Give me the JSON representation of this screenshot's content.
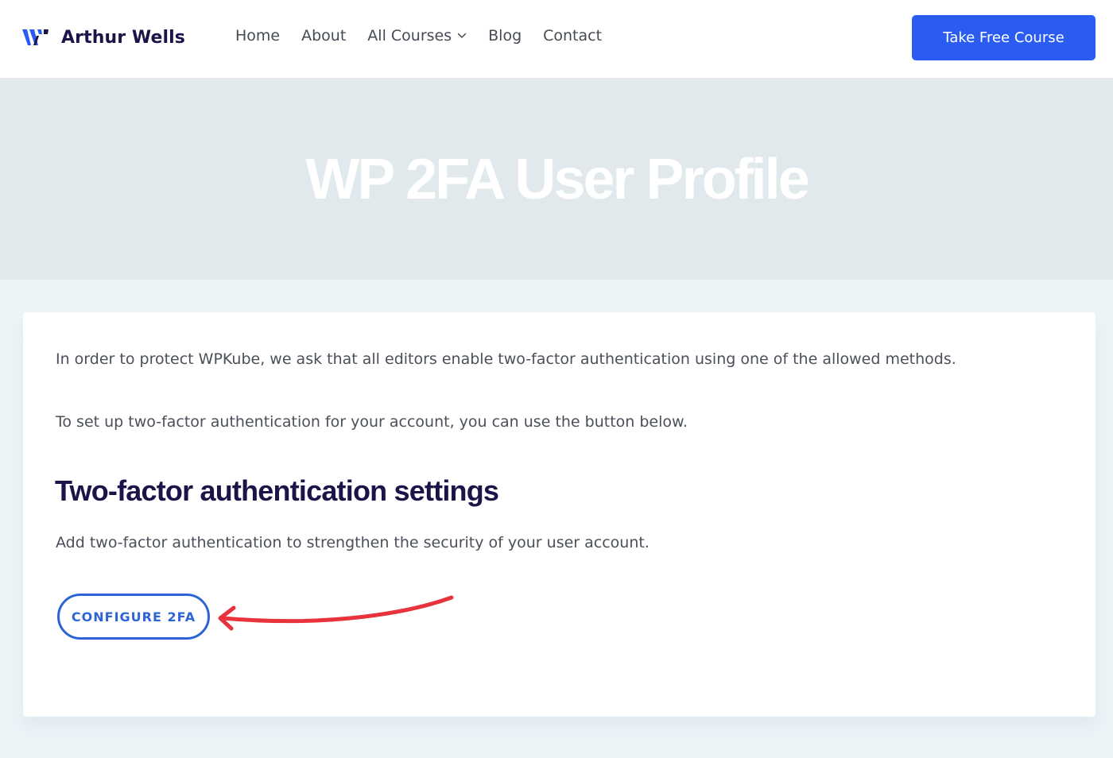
{
  "header": {
    "logo_text": "Arthur Wells",
    "logo_icon": "w-logo-icon",
    "nav": [
      {
        "label": "Home"
      },
      {
        "label": "About"
      },
      {
        "label": "All Courses",
        "has_dropdown": true
      },
      {
        "label": "Blog"
      },
      {
        "label": "Contact"
      }
    ],
    "cta_label": "Take Free Course"
  },
  "hero": {
    "title": "WP 2FA User Profile"
  },
  "content": {
    "intro": "In order to protect WPKube, we ask that all editors enable two-factor authentication using one of the allowed methods.",
    "setup_note": "To set up two-factor authentication for your account, you can use the button below.",
    "section_title": "Two-factor authentication settings",
    "section_desc": "Add two-factor authentication to strengthen the security of your user account.",
    "configure_label": "CONFIGURE 2FA"
  },
  "annotation": {
    "arrow_icon": "red-arrow-icon"
  },
  "colors": {
    "brand_dark": "#1a1448",
    "cta_blue": "#2b5cf2",
    "button_blue": "#2f64d6",
    "hero_bg": "#e1e9ed",
    "page_bg": "#edf4f8",
    "arrow_red": "#e8323c"
  }
}
